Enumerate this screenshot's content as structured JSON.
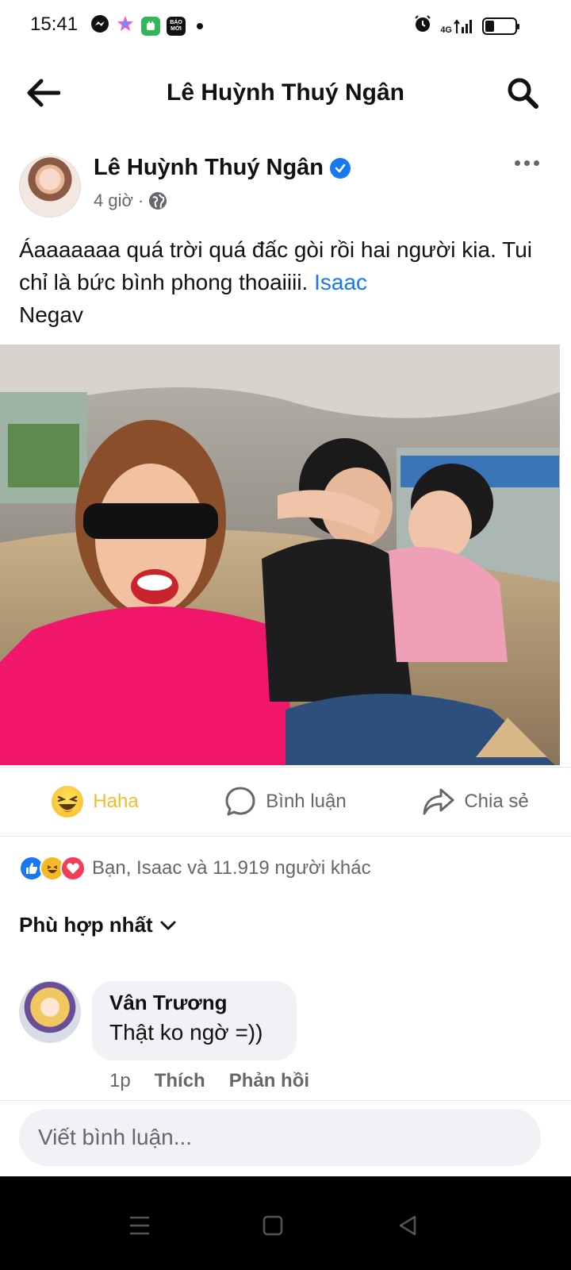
{
  "status_bar": {
    "time": "15:41",
    "apps": [
      "messenger-icon",
      "star-app-icon",
      "green-app-icon",
      "baomoi-icon"
    ],
    "baomoi_label": "BÁO MỚI",
    "network": "4G",
    "battery_level": 0.3
  },
  "header": {
    "title": "Lê Huỳnh Thuý Ngân"
  },
  "post": {
    "author": "Lê Huỳnh Thuý Ngân",
    "time": "4 giờ",
    "separator": "·",
    "text_before": "Áaaaaaaa quá trời quá đấc gòi rồi hai người kia. Tui chỉ là bức bình phong thoaiiii. ",
    "mention_1": "Isaac",
    "text_between": " ",
    "mention_2": "Negav"
  },
  "actions": {
    "react_label": "Haha",
    "comment_label": "Bình luận",
    "share_label": "Chia sẻ"
  },
  "reactions": {
    "summary": "Bạn, Isaac và 11.919 người khác",
    "types": [
      "like",
      "haha",
      "love"
    ]
  },
  "comments_sort": {
    "label": "Phù hợp nhất"
  },
  "comment": {
    "name": "Vân Trương",
    "text": "Thật ko ngờ =))",
    "time": "1p",
    "like_label": "Thích",
    "reply_label": "Phản hồi"
  },
  "composer": {
    "placeholder": "Viết bình luận..."
  },
  "colors": {
    "accent": "#1877f2",
    "haha": "#f7b928",
    "love": "#f33e58",
    "secondary_text": "#65676b",
    "bubble": "#f0f2f5"
  }
}
